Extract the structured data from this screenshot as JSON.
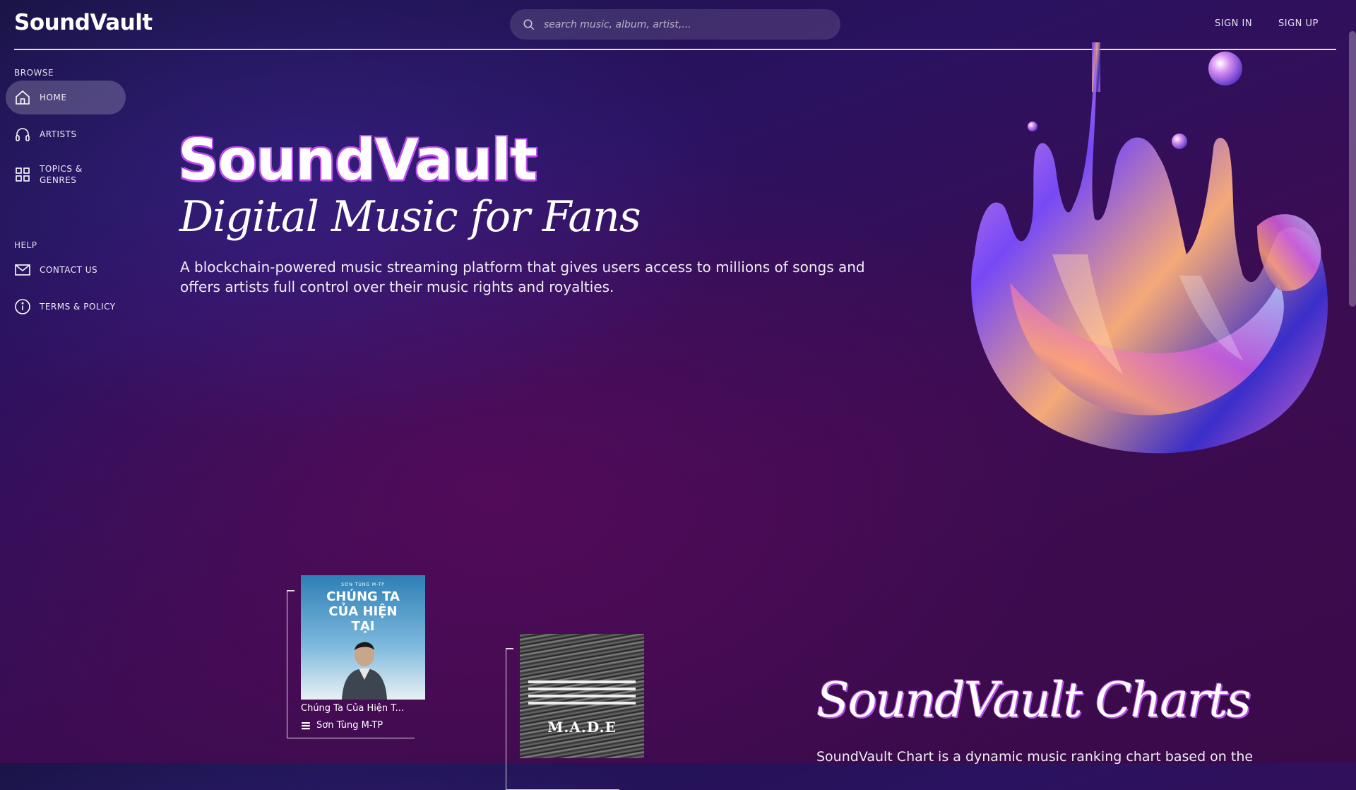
{
  "header": {
    "logo": "SoundVault",
    "search_placeholder": "search music, album, artist,...",
    "sign_in": "SIGN IN",
    "sign_up": "SIGN UP"
  },
  "sidebar": {
    "browse_label": "BROWSE",
    "items": [
      {
        "label": "HOME",
        "icon": "home-icon",
        "active": true
      },
      {
        "label": "ARTISTS",
        "icon": "headphones-icon"
      },
      {
        "label": "TOPICS & GENRES",
        "icon": "grid-icon"
      }
    ],
    "help_label": "HELP",
    "help_items": [
      {
        "label": "CONTACT US",
        "icon": "mail-icon"
      },
      {
        "label": "TERMS & POLICY",
        "icon": "info-icon"
      }
    ]
  },
  "hero": {
    "title": "SoundVault",
    "subtitle": "Digital Music for Fans",
    "description": "A blockchain-powered music streaming platform that gives users access to millions of songs and offers artists full control over their music rights and royalties."
  },
  "albums": [
    {
      "title": "Chúng Ta Của Hiện T...",
      "artist": "Sơn Tùng M-TP",
      "cover_top": "SƠN TÙNG M-TP",
      "cover_text": "CHÚNG TA CỦA HIỆN TẠI"
    },
    {
      "cover_text": "M.A.D.E"
    }
  ],
  "charts": {
    "title": "SoundVault Charts",
    "description": "SoundVault Chart is a dynamic music ranking chart based on the"
  },
  "colors": {
    "accent": "#c04cf0",
    "background_top": "#191446",
    "background_bottom": "#3a0a48"
  }
}
